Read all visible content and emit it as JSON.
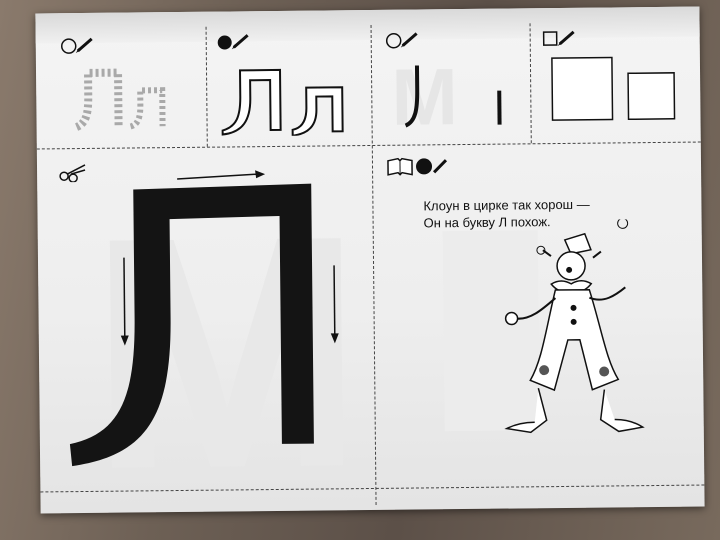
{
  "worksheet": {
    "letter_upper": "Л",
    "letter_lower": "л",
    "poem": {
      "line1": "Клоун в цирке так хорош —",
      "line2": "Он на букву Л похож."
    },
    "icons": [
      "pencil-circle-outline-icon",
      "pencil-circle-filled-icon",
      "pencil-circle-outline-icon",
      "pencil-square-outline-icon",
      "scissors-icon",
      "book-icon",
      "pencil-circle-filled-icon"
    ],
    "illustration": "clown"
  }
}
